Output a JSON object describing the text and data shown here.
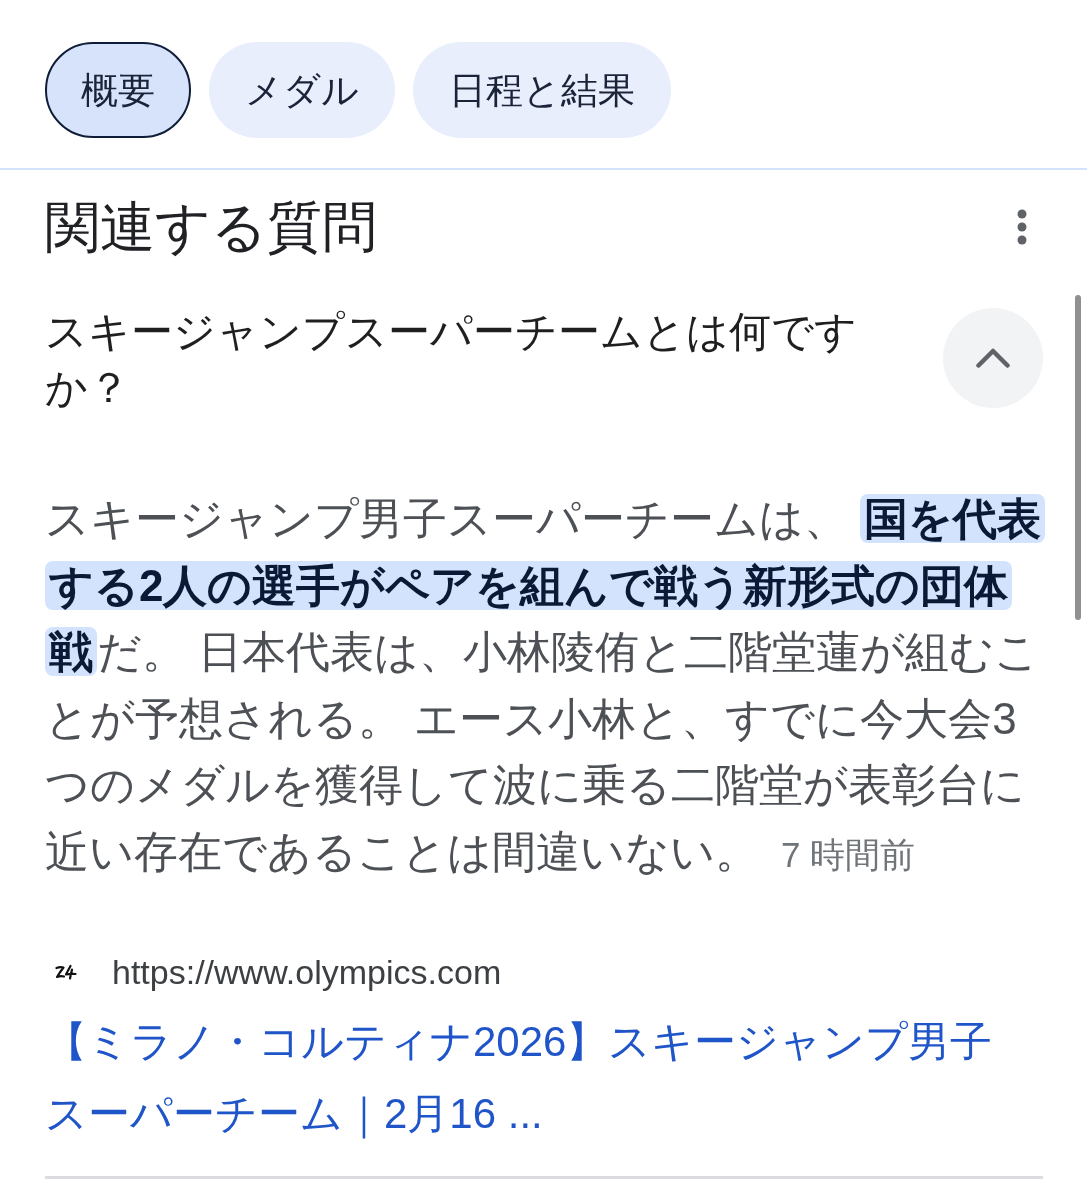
{
  "tabs": [
    {
      "label": "概要",
      "selected": true
    },
    {
      "label": "メダル",
      "selected": false
    },
    {
      "label": "日程と結果",
      "selected": false
    }
  ],
  "related_questions": {
    "title": "関連する質問",
    "items": [
      {
        "question": "スキージャンプスーパーチームとは何ですか？",
        "expanded": true,
        "answer": "スキージャンプ男子スーパーチームは、 **国を代表する2人の選手がペアを組んで戦う新形式の団体戦**だ。 日本代表は、小林陵侑と二階堂蓮が組むことが予想される。 エース小林と、すでに今大会3つのメダルを獲得して波に乗る二階堂が表彰台に近い存在であることは間違いない。",
        "time": "7 時間前",
        "source": {
          "url": "https://www.olympics.com",
          "title": "【ミラノ・コルティナ2026】スキージャンプ男子スーパーチーム｜2月16 ..."
        }
      }
    ]
  }
}
